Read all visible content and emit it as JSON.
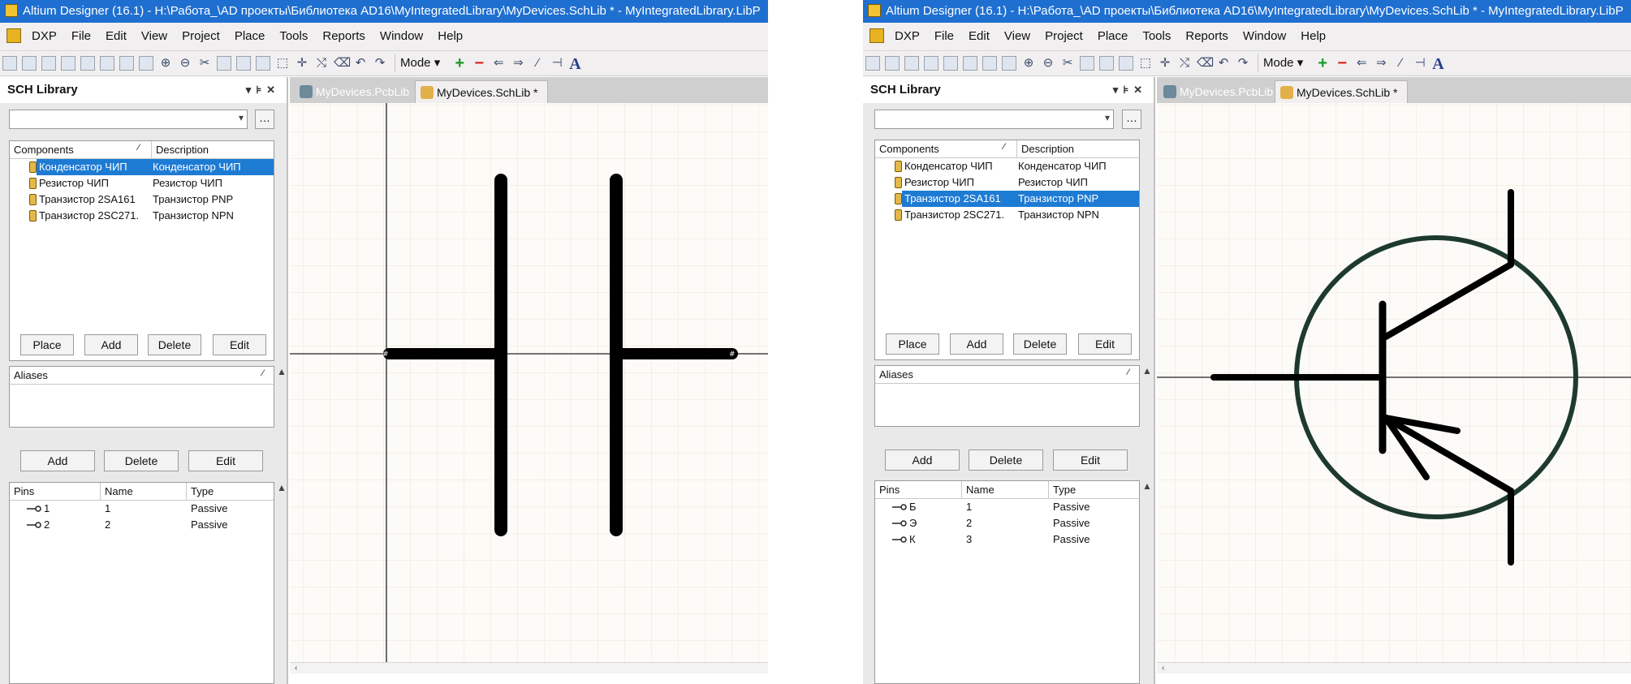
{
  "left": {
    "title": "Altium Designer (16.1) - H:\\Работа_\\AD проекты\\Библиотека AD16\\MyIntegratedLibrary\\MyDevices.SchLib * - MyIntegratedLibrary.LibP",
    "menu": [
      "DXP",
      "File",
      "Edit",
      "View",
      "Project",
      "Place",
      "Tools",
      "Reports",
      "Window",
      "Help"
    ],
    "mode_label": "Mode",
    "panel_title": "SCH Library",
    "components_header": "Components",
    "description_header": "Description",
    "components": [
      {
        "name": "Конденсатор ЧИП",
        "description": "Конденсатор ЧИП",
        "selected": true
      },
      {
        "name": "Резистор ЧИП",
        "description": "Резистор ЧИП",
        "selected": false
      },
      {
        "name": "Транзистор 2SA161",
        "description": "Транзистор PNP",
        "selected": false
      },
      {
        "name": "Транзистор 2SC271.",
        "description": "Транзистор NPN",
        "selected": false
      }
    ],
    "comp_buttons": [
      "Place",
      "Add",
      "Delete",
      "Edit"
    ],
    "aliases_header": "Aliases",
    "alias_buttons": [
      "Add",
      "Delete",
      "Edit"
    ],
    "pins_headers": [
      "Pins",
      "Name",
      "Type"
    ],
    "pins": [
      {
        "pin": "1",
        "name": "1",
        "type": "Passive"
      },
      {
        "pin": "2",
        "name": "2",
        "type": "Passive"
      }
    ],
    "tabs": [
      "MyDevices.PcbLib",
      "MyDevices.SchLib *"
    ]
  },
  "right": {
    "title": "Altium Designer (16.1) - H:\\Работа_\\AD проекты\\Библиотека AD16\\MyIntegratedLibrary\\MyDevices.SchLib * - MyIntegratedLibrary.LibP",
    "menu": [
      "DXP",
      "File",
      "Edit",
      "View",
      "Project",
      "Place",
      "Tools",
      "Reports",
      "Window",
      "Help"
    ],
    "mode_label": "Mode",
    "panel_title": "SCH Library",
    "components_header": "Components",
    "description_header": "Description",
    "components": [
      {
        "name": "Конденсатор ЧИП",
        "description": "Конденсатор ЧИП",
        "selected": false
      },
      {
        "name": "Резистор ЧИП",
        "description": "Резистор ЧИП",
        "selected": false
      },
      {
        "name": "Транзистор 2SA161",
        "description": "Транзистор PNP",
        "selected": true
      },
      {
        "name": "Транзистор 2SC271.",
        "description": "Транзистор NPN",
        "selected": false
      }
    ],
    "comp_buttons": [
      "Place",
      "Add",
      "Delete",
      "Edit"
    ],
    "aliases_header": "Aliases",
    "alias_buttons": [
      "Add",
      "Delete",
      "Edit"
    ],
    "pins_headers": [
      "Pins",
      "Name",
      "Type"
    ],
    "pins": [
      {
        "pin": "Б",
        "name": "1",
        "type": "Passive"
      },
      {
        "pin": "Э",
        "name": "2",
        "type": "Passive"
      },
      {
        "pin": "К",
        "name": "3",
        "type": "Passive"
      }
    ],
    "tabs": [
      "MyDevices.PcbLib",
      "MyDevices.SchLib *"
    ]
  },
  "colors": {
    "titlebar": "#1f6fd0",
    "selection": "#1e7bd4",
    "canvas": "#fdfbf7",
    "grid": "#ece6d6",
    "symbol": "#000000",
    "transistor_circle": "#1e3a2e"
  }
}
